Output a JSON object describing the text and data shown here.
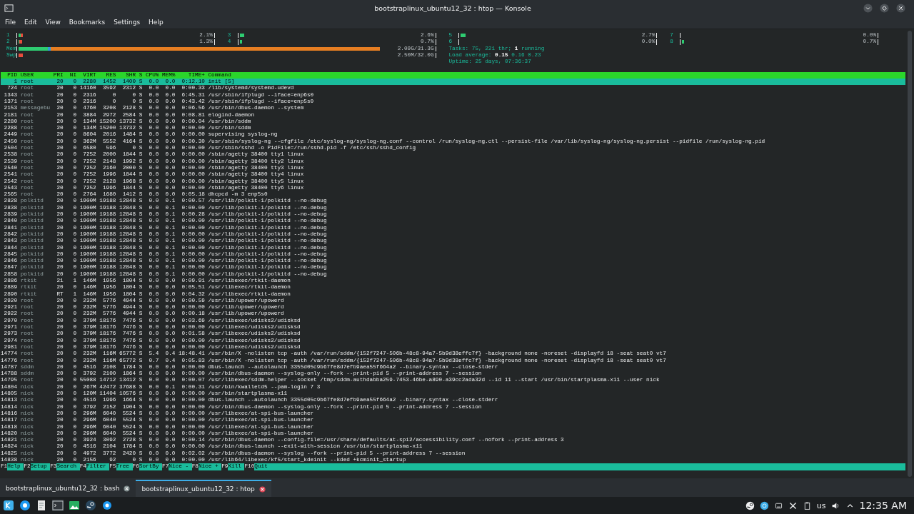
{
  "window": {
    "title": "bootstraplinux_ubuntu12_32 : htop — Konsole"
  },
  "menu": [
    "File",
    "Edit",
    "View",
    "Bookmarks",
    "Settings",
    "Help"
  ],
  "cpus": [
    {
      "label": "1",
      "reading": "2.1%",
      "segments": [
        {
          "color": "#2ecc71",
          "level": 0.012
        },
        {
          "color": "#e74c3c",
          "level": 0.024
        }
      ]
    },
    {
      "label": "2",
      "reading": "1.3%",
      "segments": [
        {
          "color": "#2ecc71",
          "level": 0.006
        },
        {
          "color": "#e74c3c",
          "level": 0.018
        }
      ]
    },
    {
      "label": "3",
      "reading": "2.6%",
      "segments": [
        {
          "color": "#2ecc71",
          "level": 0.024
        }
      ]
    },
    {
      "label": "4",
      "reading": "0.7%",
      "segments": [
        {
          "color": "#2ecc71",
          "level": 0.012
        }
      ]
    },
    {
      "label": "5",
      "reading": "2.7%",
      "segments": [
        {
          "color": "#2ecc71",
          "level": 0.024
        }
      ]
    },
    {
      "label": "6",
      "reading": "0.0%"
    },
    {
      "label": "7",
      "reading": "0.0%"
    },
    {
      "label": "8",
      "reading": "0.7%",
      "segments": [
        {
          "color": "#2ecc71",
          "level": 0.012
        }
      ]
    }
  ],
  "mem": {
    "label": "Mem",
    "reading": "2.09G/31.3G",
    "segments": [
      {
        "color": "#2ecc71",
        "level": 0.07
      },
      {
        "color": "#3498db",
        "level": 0.078
      },
      {
        "color": "#e67e22",
        "level": 0.87
      }
    ]
  },
  "swap": {
    "label": "Swp",
    "reading": "2.50M/32.0G",
    "segments": [
      {
        "color": "#e74c3c",
        "level": 0.01
      }
    ]
  },
  "stats": [
    "Tasks: 75, 221 thr; **1** running",
    "Load average: **0.15** 0.16 0.23",
    "Uptime: 25 days, 07:36:37"
  ],
  "columns": [
    "PID",
    "USER",
    "PRI",
    "NI",
    "VIRT",
    "RES",
    "SHR",
    "S",
    "CPU%",
    "MEM%",
    "TIME+",
    "Command"
  ],
  "rows": [
    {
      "selected": true,
      "cells": [
        "1",
        "root",
        "20",
        "0",
        "2280",
        "1452",
        "1400",
        "S",
        "0.0",
        "0.0",
        "0:12.10",
        "init [5]"
      ]
    },
    {
      "selected": false,
      "cells": [
        "724",
        "root",
        "20",
        "0",
        "14160",
        "3592",
        "2312",
        "S",
        "0.0",
        "0.0",
        "0:00.33",
        "/lib/systemd/systemd-udevd"
      ]
    },
    {
      "selected": false,
      "cells": [
        "1343",
        "root",
        "20",
        "0",
        "2316",
        "0",
        "0",
        "S",
        "0.0",
        "0.0",
        "6:45.31",
        "/usr/sbin/ifplugd --iface=enp6s0"
      ]
    },
    {
      "selected": false,
      "cells": [
        "1371",
        "root",
        "20",
        "0",
        "2316",
        "0",
        "0",
        "S",
        "0.0",
        "0.0",
        "0:43.42",
        "/usr/sbin/ifplugd --iface=enp5s0"
      ]
    },
    {
      "selected": false,
      "cells": [
        "2153",
        "messagebu",
        "20",
        "0",
        "4760",
        "3208",
        "2128",
        "S",
        "0.0",
        "0.0",
        "0:06.56",
        "/usr/bin/dbus-daemon --system"
      ]
    },
    {
      "selected": false,
      "cells": [
        "2181",
        "root",
        "20",
        "0",
        "3884",
        "2972",
        "2584",
        "S",
        "0.0",
        "0.0",
        "0:08.81",
        "elogind-daemon"
      ]
    },
    {
      "selected": false,
      "cells": [
        "2280",
        "root",
        "20",
        "0",
        "134M",
        "15200",
        "13732",
        "S",
        "0.0",
        "0.0",
        "0:00.04",
        "/usr/bin/sddm"
      ]
    },
    {
      "selected": false,
      "cells": [
        "2288",
        "root",
        "20",
        "0",
        "134M",
        "15200",
        "13732",
        "S",
        "0.0",
        "0.0",
        "0:00.00",
        "/usr/bin/sddm"
      ]
    },
    {
      "selected": false,
      "cells": [
        "2449",
        "root",
        "20",
        "0",
        "8604",
        "2016",
        "1484",
        "S",
        "0.0",
        "0.0",
        "0:00.00",
        "supervising syslog-ng"
      ]
    },
    {
      "selected": false,
      "cells": [
        "2450",
        "root",
        "20",
        "0",
        "362M",
        "5552",
        "4164",
        "S",
        "0.0",
        "0.0",
        "0:00.30",
        "/usr/sbin/syslog-ng --cfgfile /etc/syslog-ng/syslog-ng.conf --control /run/syslog-ng.ctl --persist-file /var/lib/syslog-ng/syslog-ng.persist --pidfile /run/syslog-ng.pid"
      ]
    },
    {
      "selected": false,
      "cells": [
        "2504",
        "root",
        "20",
        "0",
        "6580",
        "596",
        "0",
        "S",
        "0.0",
        "0.0",
        "0:00.00",
        "/usr/sbin/sshd -o PidFile=/run/sshd.pid -f /etc/ssh/sshd_config"
      ]
    },
    {
      "selected": false,
      "cells": [
        "2538",
        "root",
        "20",
        "0",
        "7252",
        "2000",
        "1844",
        "S",
        "0.0",
        "0.0",
        "0:00.00",
        "/sbin/agetty 38400 tty1 linux"
      ]
    },
    {
      "selected": false,
      "cells": [
        "2539",
        "root",
        "20",
        "0",
        "7252",
        "2148",
        "1992",
        "S",
        "0.0",
        "0.0",
        "0:00.00",
        "/sbin/agetty 38400 tty2 linux"
      ]
    },
    {
      "selected": false,
      "cells": [
        "2540",
        "root",
        "20",
        "0",
        "7252",
        "2160",
        "2000",
        "S",
        "0.0",
        "0.0",
        "0:00.00",
        "/sbin/agetty 38400 tty3 linux"
      ]
    },
    {
      "selected": false,
      "cells": [
        "2541",
        "root",
        "20",
        "0",
        "7252",
        "1996",
        "1844",
        "S",
        "0.0",
        "0.0",
        "0:00.00",
        "/sbin/agetty 38400 tty4 linux"
      ]
    },
    {
      "selected": false,
      "cells": [
        "2542",
        "root",
        "20",
        "0",
        "7252",
        "2128",
        "1968",
        "S",
        "0.0",
        "0.0",
        "0:00.00",
        "/sbin/agetty 38400 tty5 linux"
      ]
    },
    {
      "selected": false,
      "cells": [
        "2543",
        "root",
        "20",
        "0",
        "7252",
        "1996",
        "1844",
        "S",
        "0.0",
        "0.0",
        "0:00.00",
        "/sbin/agetty 38400 tty6 linux"
      ]
    },
    {
      "selected": false,
      "cells": [
        "2565",
        "root",
        "20",
        "0",
        "2764",
        "1680",
        "1412",
        "S",
        "0.0",
        "0.0",
        "0:05.18",
        "dhcpcd -m 3 enp5s0"
      ]
    },
    {
      "selected": false,
      "cells": [
        "2828",
        "polkitd",
        "20",
        "0",
        "1900M",
        "19188",
        "12848",
        "S",
        "0.0",
        "0.1",
        "0:00.57",
        "/usr/lib/polkit-1/polkitd --no-debug"
      ]
    },
    {
      "selected": false,
      "cells": [
        "2838",
        "polkitd",
        "20",
        "0",
        "1900M",
        "19188",
        "12848",
        "S",
        "0.0",
        "0.1",
        "0:00.00",
        "/usr/lib/polkit-1/polkitd --no-debug"
      ]
    },
    {
      "selected": false,
      "cells": [
        "2839",
        "polkitd",
        "20",
        "0",
        "1900M",
        "19188",
        "12848",
        "S",
        "0.0",
        "0.1",
        "0:00.28",
        "/usr/lib/polkit-1/polkitd --no-debug"
      ]
    },
    {
      "selected": false,
      "cells": [
        "2840",
        "polkitd",
        "20",
        "0",
        "1900M",
        "19188",
        "12848",
        "S",
        "0.0",
        "0.1",
        "0:00.00",
        "/usr/lib/polkit-1/polkitd --no-debug"
      ]
    },
    {
      "selected": false,
      "cells": [
        "2841",
        "polkitd",
        "20",
        "0",
        "1900M",
        "19188",
        "12848",
        "S",
        "0.0",
        "0.1",
        "0:00.00",
        "/usr/lib/polkit-1/polkitd --no-debug"
      ]
    },
    {
      "selected": false,
      "cells": [
        "2842",
        "polkitd",
        "20",
        "0",
        "1900M",
        "19188",
        "12848",
        "S",
        "0.0",
        "0.1",
        "0:00.00",
        "/usr/lib/polkit-1/polkitd --no-debug"
      ]
    },
    {
      "selected": false,
      "cells": [
        "2843",
        "polkitd",
        "20",
        "0",
        "1900M",
        "19188",
        "12848",
        "S",
        "0.0",
        "0.1",
        "0:00.00",
        "/usr/lib/polkit-1/polkitd --no-debug"
      ]
    },
    {
      "selected": false,
      "cells": [
        "2844",
        "polkitd",
        "20",
        "0",
        "1900M",
        "19188",
        "12848",
        "S",
        "0.0",
        "0.1",
        "0:00.00",
        "/usr/lib/polkit-1/polkitd --no-debug"
      ]
    },
    {
      "selected": false,
      "cells": [
        "2845",
        "polkitd",
        "20",
        "0",
        "1900M",
        "19188",
        "12848",
        "S",
        "0.0",
        "0.1",
        "0:00.00",
        "/usr/lib/polkit-1/polkitd --no-debug"
      ]
    },
    {
      "selected": false,
      "cells": [
        "2846",
        "polkitd",
        "20",
        "0",
        "1900M",
        "19188",
        "12848",
        "S",
        "0.0",
        "0.1",
        "0:00.00",
        "/usr/lib/polkit-1/polkitd --no-debug"
      ]
    },
    {
      "selected": false,
      "cells": [
        "2847",
        "polkitd",
        "20",
        "0",
        "1900M",
        "19188",
        "12848",
        "S",
        "0.0",
        "0.1",
        "0:00.00",
        "/usr/lib/polkit-1/polkitd --no-debug"
      ]
    },
    {
      "selected": false,
      "cells": [
        "2858",
        "polkitd",
        "20",
        "0",
        "1900M",
        "19188",
        "12848",
        "S",
        "0.0",
        "0.1",
        "0:00.00",
        "/usr/lib/polkit-1/polkitd --no-debug"
      ]
    },
    {
      "selected": false,
      "cells": [
        "2886",
        "rtkit",
        "21",
        "1",
        "146M",
        "1956",
        "1804",
        "S",
        "0.0",
        "0.0",
        "0:09.91",
        "/usr/libexec/rtkit-daemon"
      ]
    },
    {
      "selected": false,
      "cells": [
        "2889",
        "rtkit",
        "20",
        "0",
        "146M",
        "1956",
        "1804",
        "S",
        "0.0",
        "0.0",
        "0:05.51",
        "/usr/libexec/rtkit-daemon"
      ]
    },
    {
      "selected": false,
      "cells": [
        "2890",
        "rtkit",
        "RT",
        "1",
        "146M",
        "1956",
        "1804",
        "S",
        "0.0",
        "0.0",
        "0:04.32",
        "/usr/libexec/rtkit-daemon"
      ]
    },
    {
      "selected": false,
      "cells": [
        "2920",
        "root",
        "20",
        "0",
        "232M",
        "5776",
        "4944",
        "S",
        "0.0",
        "0.0",
        "0:00.59",
        "/usr/lib/upower/upowerd"
      ]
    },
    {
      "selected": false,
      "cells": [
        "2921",
        "root",
        "20",
        "0",
        "232M",
        "5776",
        "4944",
        "S",
        "0.0",
        "0.0",
        "0:00.00",
        "/usr/lib/upower/upowerd"
      ]
    },
    {
      "selected": false,
      "cells": [
        "2922",
        "root",
        "20",
        "0",
        "232M",
        "5776",
        "4944",
        "S",
        "0.0",
        "0.0",
        "0:00.18",
        "/usr/lib/upower/upowerd"
      ]
    },
    {
      "selected": false,
      "cells": [
        "2970",
        "root",
        "20",
        "0",
        "379M",
        "18176",
        "7476",
        "S",
        "0.0",
        "0.0",
        "0:03.69",
        "/usr/libexec/udisks2/udisksd"
      ]
    },
    {
      "selected": false,
      "cells": [
        "2971",
        "root",
        "20",
        "0",
        "379M",
        "18176",
        "7476",
        "S",
        "0.0",
        "0.0",
        "0:00.00",
        "/usr/libexec/udisks2/udisksd"
      ]
    },
    {
      "selected": false,
      "cells": [
        "2973",
        "root",
        "20",
        "0",
        "379M",
        "18176",
        "7476",
        "S",
        "0.0",
        "0.0",
        "0:01.58",
        "/usr/libexec/udisks2/udisksd"
      ]
    },
    {
      "selected": false,
      "cells": [
        "2974",
        "root",
        "20",
        "0",
        "379M",
        "18176",
        "7476",
        "S",
        "0.0",
        "0.0",
        "0:00.00",
        "/usr/libexec/udisks2/udisksd"
      ]
    },
    {
      "selected": false,
      "cells": [
        "2981",
        "root",
        "20",
        "0",
        "379M",
        "18176",
        "7476",
        "S",
        "0.0",
        "0.0",
        "0:00.00",
        "/usr/libexec/udisks2/udisksd"
      ]
    },
    {
      "selected": false,
      "cells": [
        "14774",
        "root",
        "20",
        "0",
        "232M",
        "116M",
        "65772",
        "S",
        "5.4",
        "0.4",
        "18:48.41",
        "/usr/bin/X -nolisten tcp -auth /var/run/sddm/{152f7247-506b-48c8-94a7-5b9d38effc7f} -background none -noreset -displayfd 18 -seat seat0 vt7"
      ]
    },
    {
      "selected": false,
      "cells": [
        "14776",
        "root",
        "20",
        "0",
        "232M",
        "116M",
        "65772",
        "S",
        "0.7",
        "0.4",
        "0:05.83",
        "/usr/bin/X -nolisten tcp -auth /var/run/sddm/{152f7247-506b-48c8-94a7-5b9d38effc7f} -background none -noreset -displayfd 18 -seat seat0 vt7"
      ]
    },
    {
      "selected": false,
      "cells": [
        "14787",
        "sddm",
        "20",
        "0",
        "4516",
        "2108",
        "1784",
        "S",
        "0.0",
        "0.0",
        "0:00.00",
        "dbus-launch --autolaunch 3355d05c9b67fe8d7efb9aea55f664a2 --binary-syntax --close-stderr"
      ]
    },
    {
      "selected": false,
      "cells": [
        "14788",
        "sddm",
        "20",
        "0",
        "3792",
        "2100",
        "1864",
        "S",
        "0.0",
        "0.0",
        "0:00.00",
        "/usr/bin/dbus-daemon --syslog-only --fork --print-pid 5 --print-address 7 --session"
      ]
    },
    {
      "selected": false,
      "cells": [
        "14795",
        "root",
        "20",
        "0",
        "55088",
        "14712",
        "13412",
        "S",
        "0.0",
        "0.0",
        "0:00.07",
        "/usr/libexec/sddm-helper --socket /tmp/sddm-authdabba259-7453-46be-a890-a39cc2ada32d --id 11 --start /usr/bin/startplasma-x11 --user nick"
      ]
    },
    {
      "selected": false,
      "cells": [
        "14804",
        "nick",
        "20",
        "0",
        "267M",
        "42472",
        "37688",
        "S",
        "0.0",
        "0.1",
        "0:00.31",
        "/usr/bin/kwalletd5 --pam-login 7 3"
      ]
    },
    {
      "selected": false,
      "cells": [
        "14805",
        "nick",
        "20",
        "0",
        "120M",
        "11404",
        "10576",
        "S",
        "0.0",
        "0.0",
        "0:00.00",
        "/usr/bin/startplasma-x11"
      ]
    },
    {
      "selected": false,
      "cells": [
        "14813",
        "nick",
        "20",
        "0",
        "4516",
        "1996",
        "1664",
        "S",
        "0.0",
        "0.0",
        "0:00.00",
        "dbus-launch --autolaunch 3355d05c9b67fe8d7efb9aea55f664a2 --binary-syntax --close-stderr"
      ]
    },
    {
      "selected": false,
      "cells": [
        "14814",
        "nick",
        "20",
        "0",
        "3792",
        "2152",
        "1904",
        "S",
        "0.0",
        "0.0",
        "0:00.00",
        "/usr/bin/dbus-daemon --syslog-only --fork --print-pid 5 --print-address 7 --session"
      ]
    },
    {
      "selected": false,
      "cells": [
        "14816",
        "nick",
        "20",
        "0",
        "296M",
        "6040",
        "5524",
        "S",
        "0.0",
        "0.0",
        "0:00.00",
        "/usr/libexec/at-spi-bus-launcher"
      ]
    },
    {
      "selected": false,
      "cells": [
        "14817",
        "nick",
        "20",
        "0",
        "296M",
        "6040",
        "5524",
        "S",
        "0.0",
        "0.0",
        "0:00.00",
        "/usr/libexec/at-spi-bus-launcher"
      ]
    },
    {
      "selected": false,
      "cells": [
        "14818",
        "nick",
        "20",
        "0",
        "296M",
        "6040",
        "5524",
        "S",
        "0.0",
        "0.0",
        "0:00.00",
        "/usr/libexec/at-spi-bus-launcher"
      ]
    },
    {
      "selected": false,
      "cells": [
        "14820",
        "nick",
        "20",
        "0",
        "296M",
        "6040",
        "5524",
        "S",
        "0.0",
        "0.0",
        "0:00.00",
        "/usr/libexec/at-spi-bus-launcher"
      ]
    },
    {
      "selected": false,
      "cells": [
        "14821",
        "nick",
        "20",
        "0",
        "3924",
        "3092",
        "2728",
        "S",
        "0.0",
        "0.0",
        "0:00.14",
        "/usr/bin/dbus-daemon --config-file=/usr/share/defaults/at-spi2/accessibility.conf --nofork --print-address 3"
      ]
    },
    {
      "selected": false,
      "cells": [
        "14824",
        "nick",
        "20",
        "0",
        "4516",
        "2104",
        "1784",
        "S",
        "0.0",
        "0.0",
        "0:00.00",
        "/usr/bin/dbus-launch --exit-with-session /usr/bin/startplasma-x11"
      ]
    },
    {
      "selected": false,
      "cells": [
        "14825",
        "nick",
        "20",
        "0",
        "4972",
        "3772",
        "2420",
        "S",
        "0.0",
        "0.0",
        "0:02.02",
        "/usr/bin/dbus-daemon --syslog --fork --print-pid 5 --print-address 7 --session"
      ]
    },
    {
      "selected": false,
      "cells": [
        "14838",
        "nick",
        "20",
        "0",
        "2156",
        "92",
        "0",
        "S",
        "0.0",
        "0.0",
        "0:00.00",
        "/usr/lib64/libexec/kf5/start_kdeinit --kded +kcminit_startup"
      ]
    }
  ],
  "function_keys": [
    {
      "key": "F1",
      "label": "Help"
    },
    {
      "key": "F2",
      "label": "Setup"
    },
    {
      "key": "F3",
      "label": "Search"
    },
    {
      "key": "F4",
      "label": "Filter"
    },
    {
      "key": "F5",
      "label": "Tree"
    },
    {
      "key": "F6",
      "label": "SortBy"
    },
    {
      "key": "F7",
      "label": "Nice -"
    },
    {
      "key": "F8",
      "label": "Nice +"
    },
    {
      "key": "F9",
      "label": "Kill"
    },
    {
      "key": "F10",
      "label": "Quit"
    }
  ],
  "tabs": [
    {
      "label": "bootstraplinux_ubuntu12_32 : bash",
      "selected": false
    },
    {
      "label": "bootstraplinux_ubuntu12_32 : htop",
      "selected": true
    }
  ],
  "taskbar": {
    "keyboard_layout": "us",
    "clock": "12:35 AM"
  }
}
